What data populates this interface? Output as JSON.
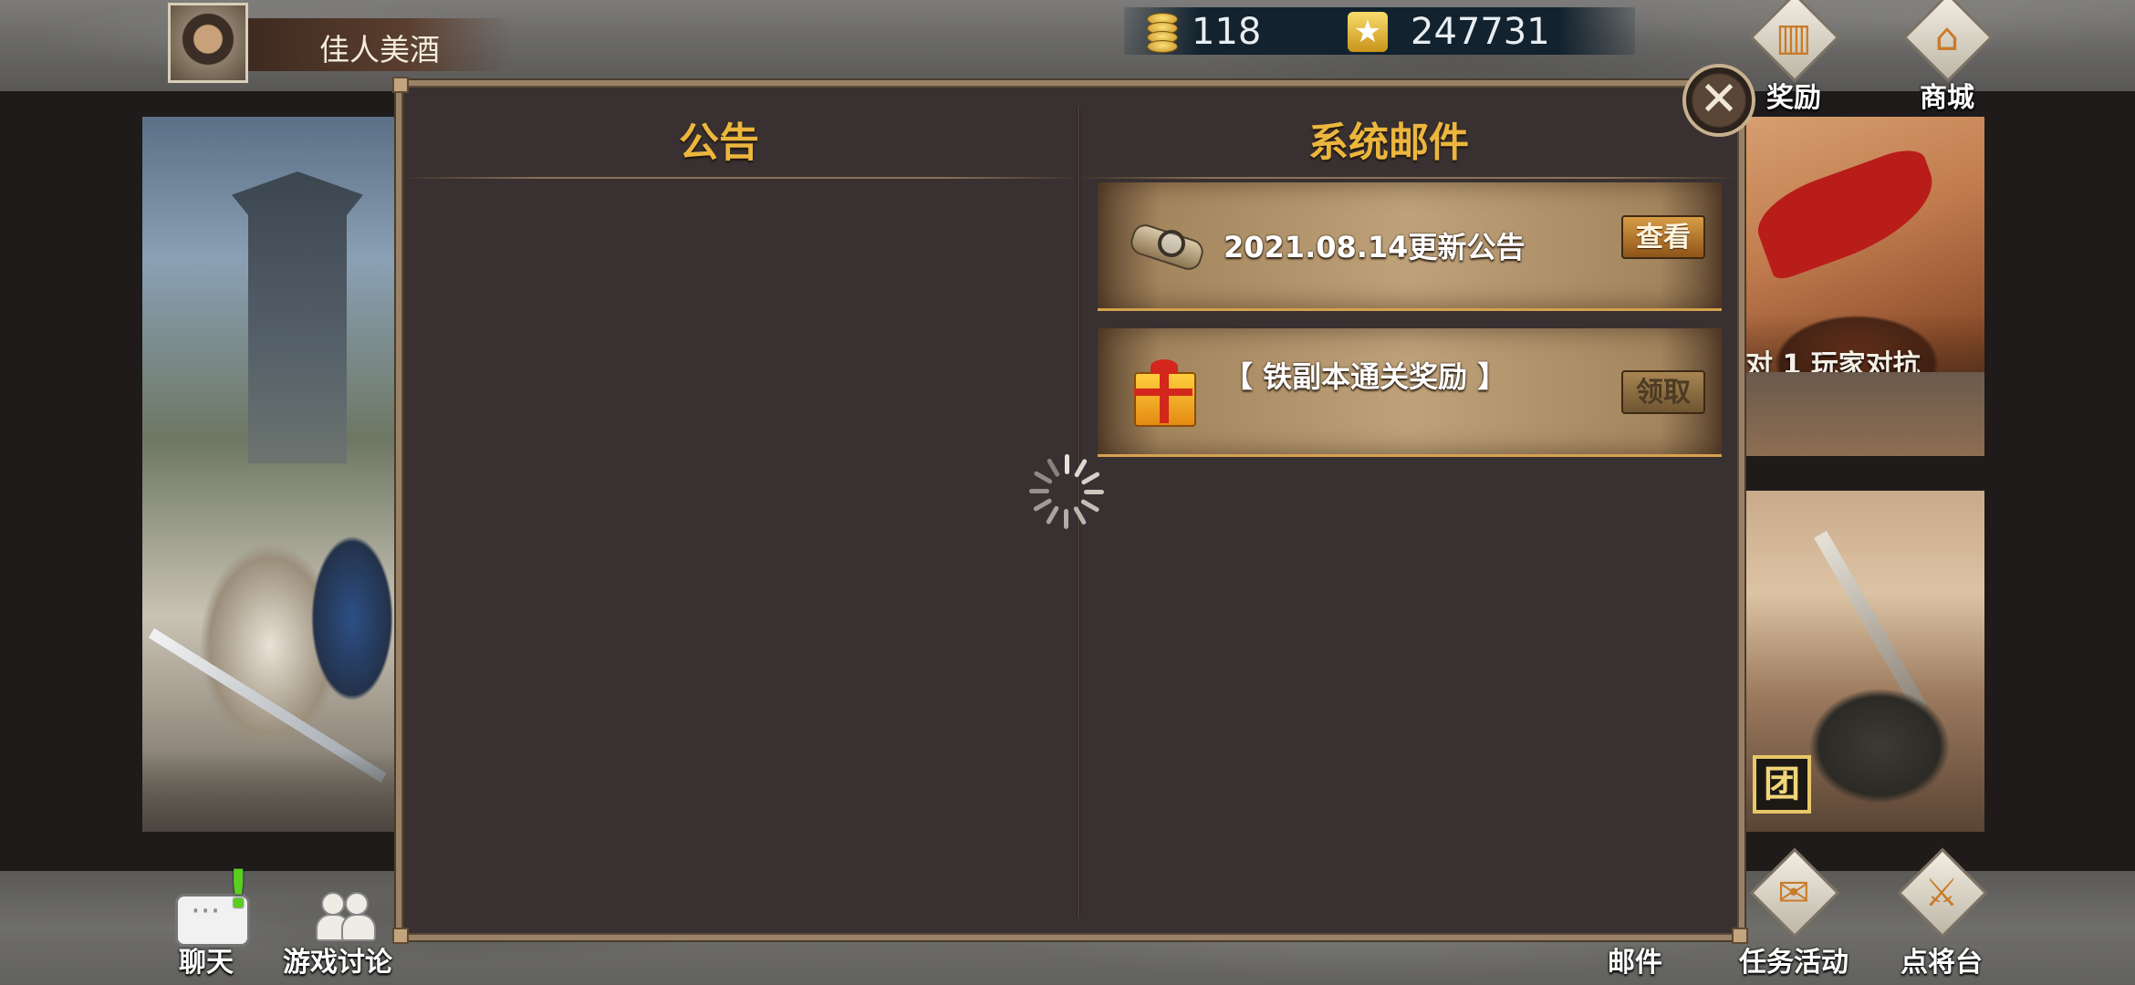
{
  "player": {
    "name": "佳人美酒"
  },
  "resources": {
    "coins": "118",
    "stars": "247731"
  },
  "top_right": {
    "reward_label": "奖励",
    "shop_label": "商城"
  },
  "banners": {
    "right_top_text": "对 1 玩家对抗",
    "right_bottom_badge": "团"
  },
  "modal": {
    "tab_announcement": "公告",
    "tab_system_mail": "系统邮件",
    "close_symbol": "✕",
    "mail_items": [
      {
        "icon": "scroll-icon",
        "title": "2021.08.14更新公告",
        "button_label": "查看"
      },
      {
        "icon": "gift-icon",
        "title": "【 铁副本通关奖励 】",
        "button_label": "领取"
      }
    ]
  },
  "bottom_bar": {
    "chat_label": "聊天",
    "chat_alert": "!",
    "forum_label": "游戏讨论",
    "mail_label": "邮件",
    "mission_label": "任务活动",
    "general_label": "点将台"
  },
  "colors": {
    "tab_title": "#ecb63d",
    "modal_bg": "#393031",
    "modal_border": "#9a8266",
    "view_button": "#c8872f",
    "chat_alert": "#58d020"
  }
}
